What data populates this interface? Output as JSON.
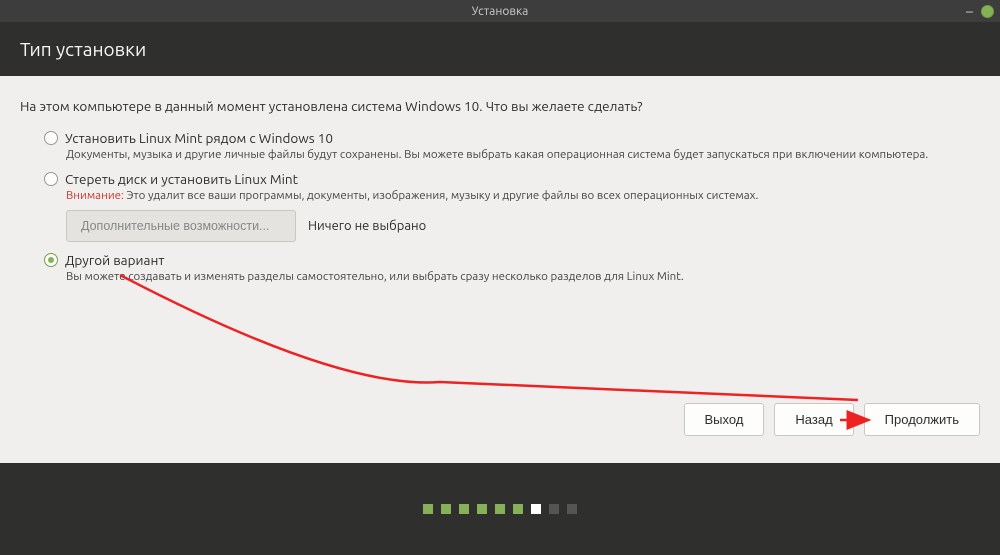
{
  "window": {
    "title": "Установка"
  },
  "header": {
    "title": "Тип установки"
  },
  "prompt": "На этом компьютере в данный момент установлена система Windows 10. Что вы желаете сделать?",
  "options": {
    "alongside": {
      "title": "Установить Linux Mint рядом с Windows 10",
      "desc": "Документы, музыка и другие личные файлы будут сохранены. Вы можете выбрать какая операционная система будет запускаться при включении компьютера."
    },
    "erase": {
      "title": "Стереть диск и установить Linux Mint",
      "warning_label": "Внимание:",
      "warning_text": " Это удалит все ваши программы, документы, изображения, музыку и другие файлы во всех операционных системах.",
      "adv_button": "Дополнительные возможности...",
      "adv_status": "Ничего не выбрано"
    },
    "other": {
      "title": "Другой вариант",
      "desc": "Вы можете создавать и изменять разделы самостоятельно, или выбрать сразу несколько разделов для Linux Mint."
    }
  },
  "buttons": {
    "quit": "Выход",
    "back": "Назад",
    "continue": "Продолжить"
  }
}
